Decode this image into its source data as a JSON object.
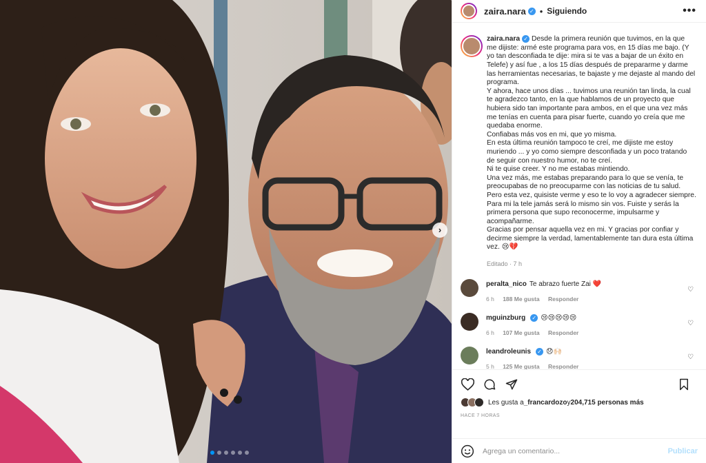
{
  "post": {
    "author": "zaira.nara",
    "follow_status": "Siguiendo",
    "more_label": "•••",
    "carousel_dots": 6
  },
  "caption": {
    "author": "zaira.nara",
    "paragraphs": [
      "Desde la primera reunión que tuvimos, en la que me dijiste: armé este programa para vos, en 15 días me bajo. (Y yo tan desconfiada te dije: mira si te vas a bajar de un éxito en Telefe) y así fue , a los 15 días después de prepararme y darme las herramientas necesarias, te bajaste y me dejaste al mando del programa.",
      "Y ahora, hace unos días ... tuvimos una reunión tan linda, la cual te agradezco tanto, en la que hablamos de un proyecto que hubiera sido tan importante para ambos, en el que una vez más me tenías en cuenta para pisar fuerte, cuando yo creía que me quedaba enorme.",
      "Confiabas más vos en mi, que yo misma.",
      "En esta última reunión tampoco te creí, me dijiste me estoy muriendo ... y yo como siempre desconfiada y un poco tratando de seguir con nuestro humor, no te creí.",
      "Ni te quise creer. Y no me estabas mintiendo.",
      "Una vez más, me estabas preparando para lo que se venía, te preocupabas de no preocuparme con las noticias de tu salud. Pero esta vez, quisiste verme y eso te lo voy a agradecer siempre.",
      "Para mi la tele jamás será lo mismo sin vos. Fuiste y serás la primera persona que supo reconocerme, impulsarme y acompañarme.",
      "Gracias por pensar aquella vez en mi. Y gracias por confiar y decirme siempre la verdad, lamentablemente tan dura esta última vez. 😢💔"
    ],
    "meta": "Editado · 7 h"
  },
  "comments": [
    {
      "user": "peralta_nico",
      "verified": false,
      "text": "Te abrazo fuerte Zai ❤️",
      "time": "6 h",
      "likes": "188 Me gusta",
      "reply": "Responder"
    },
    {
      "user": "mguinzburg",
      "verified": true,
      "text": "😢😢😢😢😢",
      "time": "6 h",
      "likes": "107 Me gusta",
      "reply": "Responder"
    },
    {
      "user": "leandroleunis",
      "verified": true,
      "text": "😞🙌🏻",
      "time": "5 h",
      "likes": "125 Me gusta",
      "reply": "Responder"
    }
  ],
  "likes": {
    "prefix": "Les gusta a ",
    "user": "_francardozo",
    "middle": " y ",
    "others": "204,715 personas más"
  },
  "time_ago": "HACE 7 HORAS",
  "add_comment": {
    "placeholder": "Agrega un comentario...",
    "post_label": "Publicar"
  },
  "colors": {
    "accent": "#0095f6",
    "verified": "#3897f0",
    "muted": "#8e8e8e",
    "text": "#262626"
  },
  "icons": [
    "heart-icon",
    "comment-icon",
    "share-icon",
    "bookmark-icon",
    "emoji-icon",
    "more-icon",
    "chevron-right-icon"
  ]
}
